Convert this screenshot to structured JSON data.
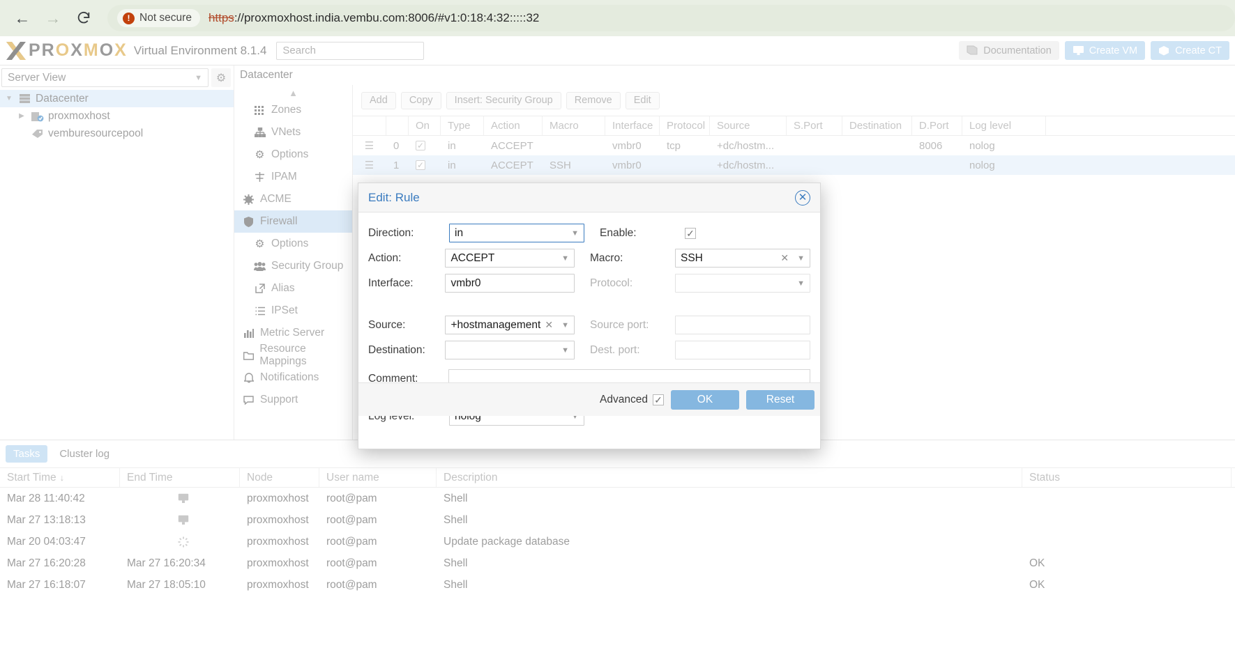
{
  "browser": {
    "back_icon": "back-arrow-icon",
    "forward_icon": "forward-arrow-icon",
    "reload_icon": "reload-icon",
    "security_label": "Not secure",
    "url_scheme": "https",
    "url_rest": "://proxmoxhost.india.vembu.com:8006/#v1:0:18:4:32:::::32",
    "full_url": "https://proxmoxhost.india.vembu.com:8006/#v1:0:18:4:32:::::32"
  },
  "pve_header": {
    "logo_x": "X",
    "logo_word": "PROXMOX",
    "env_title": "Virtual Environment 8.1.4",
    "search_placeholder": "Search",
    "buttons": [
      {
        "label": "Documentation",
        "icon": "book-icon",
        "style": "plain"
      },
      {
        "label": "Create VM",
        "icon": "monitor-icon",
        "style": "blue"
      },
      {
        "label": "Create CT",
        "icon": "box-icon",
        "style": "blue"
      }
    ]
  },
  "sidebar": {
    "view_selector": "Server View",
    "gear_icon": "gear-icon",
    "tree": [
      {
        "label": "Datacenter",
        "icon": "datacenter-icon",
        "selected": true,
        "depth": 0,
        "arrow": "expanded"
      },
      {
        "label": "proxmoxhost",
        "icon": "node-icon",
        "selected": false,
        "depth": 1,
        "arrow": "collapsed"
      },
      {
        "label": "vemburesourcepool",
        "icon": "pool-icon",
        "selected": false,
        "depth": 1,
        "arrow": "none"
      }
    ]
  },
  "content": {
    "breadcrumb": "Datacenter",
    "nav_items": [
      {
        "label": "Zones",
        "icon": "grid-icon",
        "indent": true,
        "active": false
      },
      {
        "label": "VNets",
        "icon": "network-icon",
        "indent": true,
        "active": false
      },
      {
        "label": "Options",
        "icon": "gear-icon",
        "indent": true,
        "active": false
      },
      {
        "label": "IPAM",
        "icon": "ipam-icon",
        "indent": true,
        "active": false
      },
      {
        "label": "ACME",
        "icon": "acme-icon",
        "indent": false,
        "active": false
      },
      {
        "label": "Firewall",
        "icon": "shield-icon",
        "indent": false,
        "active": true
      },
      {
        "label": "Options",
        "icon": "gear-icon",
        "indent": true,
        "active": false
      },
      {
        "label": "Security Group",
        "icon": "users-icon",
        "indent": true,
        "active": false
      },
      {
        "label": "Alias",
        "icon": "external-link-icon",
        "indent": true,
        "active": false
      },
      {
        "label": "IPSet",
        "icon": "list-icon",
        "indent": true,
        "active": false
      },
      {
        "label": "Metric Server",
        "icon": "chart-icon",
        "indent": false,
        "active": false
      },
      {
        "label": "Resource Mappings",
        "icon": "folder-icon",
        "indent": false,
        "active": false
      },
      {
        "label": "Notifications",
        "icon": "bell-icon",
        "indent": false,
        "active": false
      },
      {
        "label": "Support",
        "icon": "chat-icon",
        "indent": false,
        "active": false
      }
    ]
  },
  "rules": {
    "toolbar": [
      {
        "label": "Add"
      },
      {
        "label": "Copy"
      },
      {
        "label": "Insert: Security Group"
      },
      {
        "label": "Remove"
      },
      {
        "label": "Edit"
      }
    ],
    "columns": [
      "",
      "",
      "On",
      "Type",
      "Action",
      "Macro",
      "Interface",
      "Protocol",
      "Source",
      "S.Port",
      "Destination",
      "D.Port",
      "Log level"
    ],
    "rows": [
      {
        "index": "0",
        "on": true,
        "type": "in",
        "action": "ACCEPT",
        "macro": "",
        "interface": "vmbr0",
        "protocol": "tcp",
        "source": "+dc/hostm...",
        "sport": "",
        "destination": "",
        "dport": "8006",
        "log": "nolog",
        "selected": false
      },
      {
        "index": "1",
        "on": true,
        "type": "in",
        "action": "ACCEPT",
        "macro": "SSH",
        "interface": "vmbr0",
        "protocol": "",
        "source": "+dc/hostm...",
        "sport": "",
        "destination": "",
        "dport": "",
        "log": "nolog",
        "selected": true
      }
    ]
  },
  "modal": {
    "title": "Edit: Rule",
    "close_icon": "close-circle-icon",
    "fields": {
      "direction_label": "Direction:",
      "direction_value": "in",
      "enable_label": "Enable:",
      "enable_checked": true,
      "action_label": "Action:",
      "action_value": "ACCEPT",
      "macro_label": "Macro:",
      "macro_value": "SSH",
      "interface_label": "Interface:",
      "interface_value": "vmbr0",
      "protocol_label": "Protocol:",
      "protocol_value": "",
      "source_label": "Source:",
      "source_value": "+hostmanagement",
      "source_port_label": "Source port:",
      "source_port_value": "",
      "destination_label": "Destination:",
      "destination_value": "",
      "dest_port_label": "Dest. port:",
      "dest_port_value": "",
      "comment_label": "Comment:",
      "comment_value": "",
      "log_level_label": "Log level:",
      "log_level_value": "nolog"
    },
    "footer": {
      "advanced_label": "Advanced",
      "advanced_checked": true,
      "ok_label": "OK",
      "reset_label": "Reset"
    }
  },
  "tasks": {
    "tabs": [
      {
        "label": "Tasks",
        "active": true
      },
      {
        "label": "Cluster log",
        "active": false
      }
    ],
    "columns": [
      "Start Time",
      "End Time",
      "Node",
      "User name",
      "Description",
      "Status"
    ],
    "sort_column": "Start Time",
    "sort_direction": "desc",
    "rows": [
      {
        "start": "Mar 28 11:40:42",
        "end": "",
        "end_icon": "monitor-icon",
        "node": "proxmoxhost",
        "user": "root@pam",
        "desc": "Shell",
        "status": ""
      },
      {
        "start": "Mar 27 13:18:13",
        "end": "",
        "end_icon": "monitor-icon",
        "node": "proxmoxhost",
        "user": "root@pam",
        "desc": "Shell",
        "status": ""
      },
      {
        "start": "Mar 20 04:03:47",
        "end": "",
        "end_icon": "spinner-icon",
        "node": "proxmoxhost",
        "user": "root@pam",
        "desc": "Update package database",
        "status": ""
      },
      {
        "start": "Mar 27 16:20:28",
        "end": "Mar 27 16:20:34",
        "end_icon": "",
        "node": "proxmoxhost",
        "user": "root@pam",
        "desc": "Shell",
        "status": "OK"
      },
      {
        "start": "Mar 27 16:18:07",
        "end": "Mar 27 18:05:10",
        "end_icon": "",
        "node": "proxmoxhost",
        "user": "root@pam",
        "desc": "Shell",
        "status": "OK"
      }
    ]
  },
  "colors": {
    "accent_blue": "#3a7bbf",
    "button_blue": "#85b7e0",
    "selection_blue": "#dceaf7",
    "browser_green": "#e9efe4",
    "not_secure_orange": "#c2410c"
  }
}
